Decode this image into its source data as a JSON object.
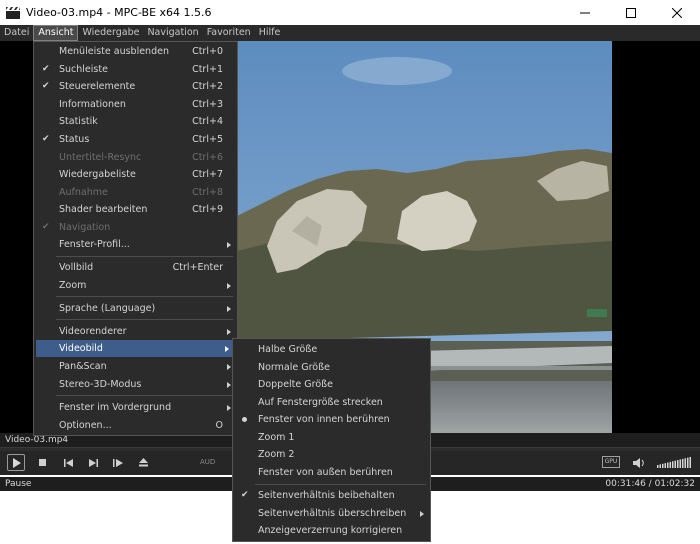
{
  "window": {
    "title": "Video-03.mp4 - MPC-BE x64 1.5.6"
  },
  "menubar": [
    "Datei",
    "Ansicht",
    "Wiedergabe",
    "Navigation",
    "Favoriten",
    "Hilfe"
  ],
  "ansicht_menu": [
    {
      "label": "Menüleiste ausblenden",
      "shortcut": "Ctrl+0"
    },
    {
      "label": "Suchleiste",
      "shortcut": "Ctrl+1"
    },
    {
      "label": "Steuerelemente",
      "shortcut": "Ctrl+2"
    },
    {
      "label": "Informationen",
      "shortcut": "Ctrl+3"
    },
    {
      "label": "Statistik",
      "shortcut": "Ctrl+4"
    },
    {
      "label": "Status",
      "shortcut": "Ctrl+5"
    },
    {
      "label": "Untertitel-Resync",
      "shortcut": "Ctrl+6"
    },
    {
      "label": "Wiedergabeliste",
      "shortcut": "Ctrl+7"
    },
    {
      "label": "Aufnahme",
      "shortcut": "Ctrl+8"
    },
    {
      "label": "Shader bearbeiten",
      "shortcut": "Ctrl+9"
    },
    {
      "label": "Navigation",
      "shortcut": ""
    },
    {
      "label": "Fenster-Profil...",
      "shortcut": ""
    },
    {
      "label": "Vollbild",
      "shortcut": "Ctrl+Enter"
    },
    {
      "label": "Zoom",
      "shortcut": ""
    },
    {
      "label": "Sprache (Language)",
      "shortcut": ""
    },
    {
      "label": "Videorenderer",
      "shortcut": ""
    },
    {
      "label": "Videobild",
      "shortcut": ""
    },
    {
      "label": "Pan&Scan",
      "shortcut": ""
    },
    {
      "label": "Stereo-3D-Modus",
      "shortcut": ""
    },
    {
      "label": "Fenster im Vordergrund",
      "shortcut": ""
    },
    {
      "label": "Optionen...",
      "shortcut": "O"
    }
  ],
  "videobild_menu": [
    {
      "label": "Halbe Größe"
    },
    {
      "label": "Normale Größe"
    },
    {
      "label": "Doppelte Größe"
    },
    {
      "label": "Auf Fenstergröße strecken"
    },
    {
      "label": "Fenster von innen berühren"
    },
    {
      "label": "Zoom 1"
    },
    {
      "label": "Zoom 2"
    },
    {
      "label": "Fenster von außen berühren"
    },
    {
      "label": "Seitenverhältnis beibehalten"
    },
    {
      "label": "Seitenverhältnis überschreiben"
    },
    {
      "label": "Anzeigeverzerrung korrigieren"
    }
  ],
  "check_mark": "✔",
  "filename": "Video-03.mp4",
  "controls": {
    "renderer_label": "AUD",
    "gpu_label": "GPU",
    "volume_level": 1.0
  },
  "status": {
    "state": "Pause",
    "time": "00:31:46 / 01:02:32"
  },
  "colors": {
    "highlight": "#3f5d8a",
    "menu_bg": "#2b2b2b",
    "disabled_text": "#6e6e6e"
  }
}
